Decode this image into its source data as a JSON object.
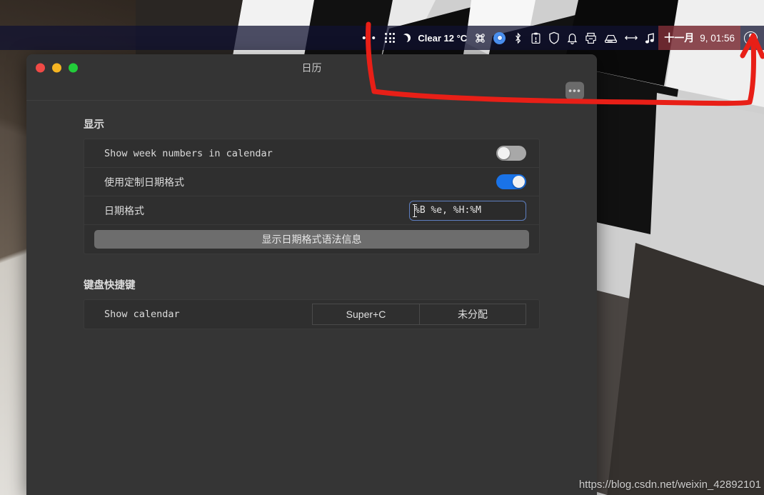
{
  "topbar": {
    "overflow_dots": "•••",
    "apps_icon": "apps-grid-icon",
    "weather_label": "Clear 12 °C",
    "moon_icon": "moon-icon",
    "command_icon": "command-key-icon",
    "chrome_icon": "chromium-icon",
    "bluetooth_icon": "bluetooth-icon",
    "clipboard_icon": "clipboard-icon",
    "shield_icon": "shield-icon",
    "bell_icon": "notification-bell-icon",
    "printer_icon": "printer-icon",
    "disk_icon": "removable-drive-icon",
    "resize_icon": "horizontal-arrows-icon",
    "music_icon": "music-note-icon",
    "date_month": "十一月",
    "date_time": "9, 01:56",
    "avatar_icon": "user-account-icon"
  },
  "window": {
    "title": "日历",
    "close_label": "close",
    "minimize_label": "minimize",
    "maximize_label": "maximize",
    "menu_button_label": "•••"
  },
  "display_section": {
    "heading": "显示",
    "rows": [
      {
        "label": "Show week numbers in calendar",
        "control": "switch",
        "state": "off"
      },
      {
        "label": "使用定制日期格式",
        "control": "switch",
        "state": "on"
      },
      {
        "label": "日期格式",
        "control": "input",
        "value": "%B %e, %H:%M"
      }
    ],
    "syntax_button": "显示日期格式语法信息"
  },
  "shortcuts_section": {
    "heading": "键盘快捷键",
    "rows": [
      {
        "label": "Show calendar",
        "binding": "Super+C",
        "secondary": "未分配"
      }
    ]
  },
  "annotation": {
    "type": "red-arrow",
    "color": "#e81f17"
  },
  "watermark": {
    "text": "https://blog.csdn.net/weixin_42892101"
  },
  "colors": {
    "window_bg": "#353535",
    "card_bg": "#2f2f2f",
    "switch_on": "#1a73e8",
    "switch_off": "#a8a8a8",
    "input_focus_border": "#5e7fc0",
    "annotation_red": "#e81f17"
  }
}
